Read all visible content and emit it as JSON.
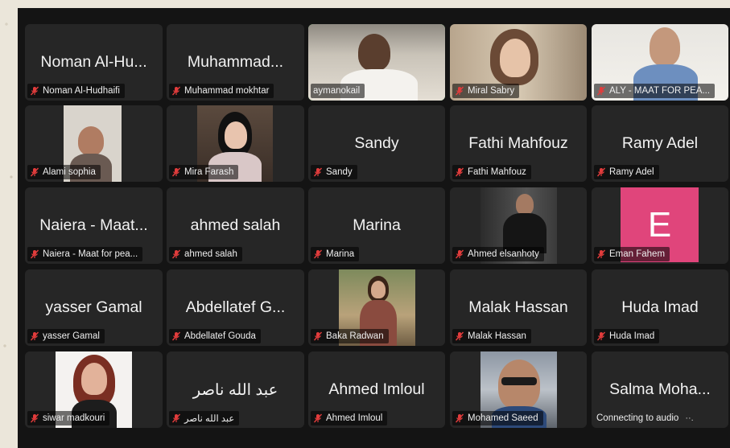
{
  "participants": [
    {
      "id": "p1",
      "big": "Noman Al-Hu...",
      "label": "Noman Al-Hudhaifi",
      "muted": true
    },
    {
      "id": "p2",
      "big": "Muhammad...",
      "label": "Muhammad mokhtar",
      "muted": true
    },
    {
      "id": "p3",
      "big": "",
      "label": "aymanokail",
      "muted": false,
      "video": true,
      "active": true
    },
    {
      "id": "p4",
      "big": "",
      "label": "Miral Sabry",
      "muted": true,
      "video": true
    },
    {
      "id": "p5",
      "big": "",
      "label": "ALY - MAAT FOR PEA...",
      "muted": true,
      "video": true
    },
    {
      "id": "p6",
      "big": "",
      "label": "Alami sophia",
      "muted": true,
      "video": true
    },
    {
      "id": "p7",
      "big": "",
      "label": "Mira Farash",
      "muted": true,
      "video": true
    },
    {
      "id": "p8",
      "big": "Sandy",
      "label": "Sandy",
      "muted": true
    },
    {
      "id": "p9",
      "big": "Fathi Mahfouz",
      "label": "Fathi Mahfouz",
      "muted": true
    },
    {
      "id": "p10",
      "big": "Ramy Adel",
      "label": "Ramy Adel",
      "muted": true
    },
    {
      "id": "p11",
      "big": "Naiera - Maat...",
      "label": "Naiera - Maat for pea...",
      "muted": false
    },
    {
      "id": "p12",
      "big": "ahmed salah",
      "label": "ahmed salah",
      "muted": true
    },
    {
      "id": "p13",
      "big": "Marina",
      "label": "Marina",
      "muted": true
    },
    {
      "id": "p14",
      "big": "",
      "label": "Ahmed elsanhoty",
      "muted": true,
      "video": true
    },
    {
      "id": "p15",
      "big": "E",
      "label": "Eman Fahem",
      "muted": true,
      "avatar": true
    },
    {
      "id": "p16",
      "big": "yasser Gamal",
      "label": "yasser Gamal",
      "muted": true
    },
    {
      "id": "p17",
      "big": "Abdellatef G...",
      "label": "Abdellatef Gouda",
      "muted": true
    },
    {
      "id": "p18",
      "big": "",
      "label": "Baka Radwan",
      "muted": true,
      "video": true
    },
    {
      "id": "p19",
      "big": "Malak Hassan",
      "label": "Malak Hassan",
      "muted": true
    },
    {
      "id": "p20",
      "big": "Huda Imad",
      "label": "Huda Imad",
      "muted": true
    },
    {
      "id": "p21",
      "big": "",
      "label": "siwar madkouri",
      "muted": true,
      "video": true
    },
    {
      "id": "p22",
      "big": "عبد الله ناصر",
      "label": "عبد الله ناصر",
      "muted": true
    },
    {
      "id": "p23",
      "big": "Ahmed Imloul",
      "label": "Ahmed Imloul",
      "muted": true
    },
    {
      "id": "p24",
      "big": "",
      "label": "Mohamed Saeed",
      "muted": true,
      "video": true
    },
    {
      "id": "p25",
      "big": "Salma Moha...",
      "label": "Connecting to audio",
      "muted": false,
      "connecting": true
    }
  ],
  "colors": {
    "muted_icon": "#e23c3c",
    "active_border": "#3fbf4f",
    "avatar_bg": "#e0457b",
    "tile_bg": "#262626"
  },
  "icons": {
    "mic_muted": "muted-mic-icon"
  }
}
